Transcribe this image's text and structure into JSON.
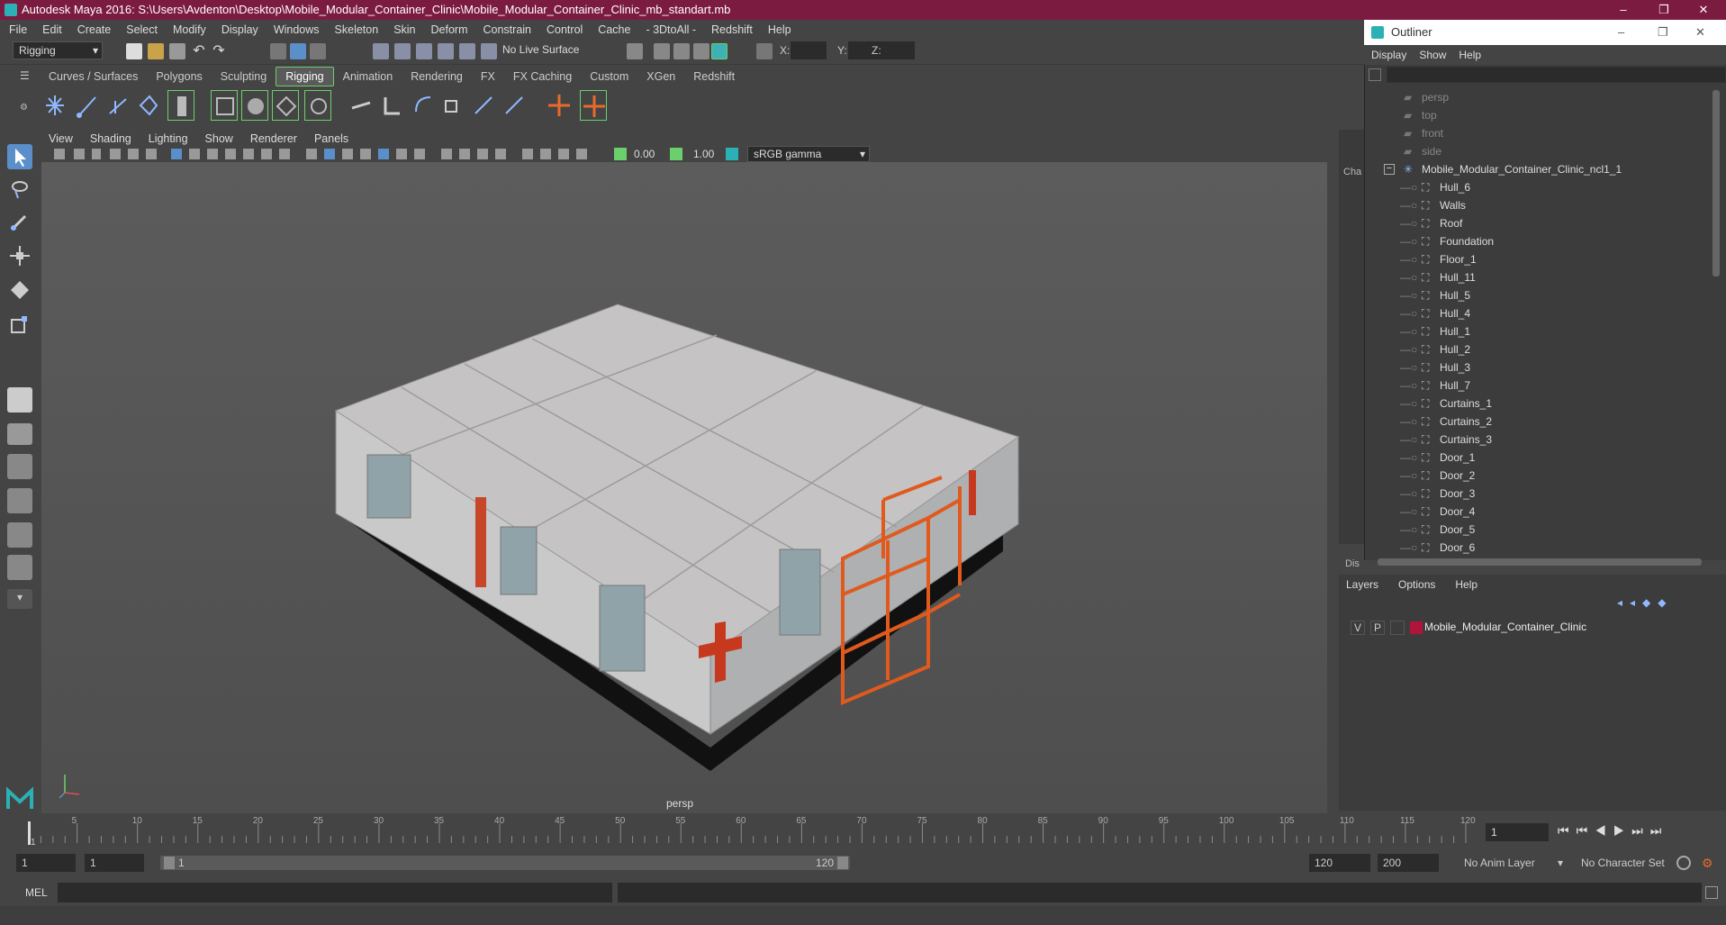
{
  "window": {
    "title": "Autodesk Maya 2016: S:\\Users\\Avdenton\\Desktop\\Mobile_Modular_Container_Clinic\\Mobile_Modular_Container_Clinic_mb_standart.mb",
    "minimize": "–",
    "maximize": "❐",
    "close": "✕"
  },
  "menubar": [
    "File",
    "Edit",
    "Create",
    "Select",
    "Modify",
    "Display",
    "Windows",
    "Skeleton",
    "Skin",
    "Deform",
    "Constrain",
    "Control",
    "Cache",
    "- 3DtoAll -",
    "Redshift",
    "Help"
  ],
  "toolbar": {
    "mode": "Rigging",
    "live_surface": "No Live Surface",
    "x_label": "X:",
    "y_label": "Y:",
    "z_label": "Z:"
  },
  "shelf_tabs": [
    "Curves / Surfaces",
    "Polygons",
    "Sculpting",
    "Rigging",
    "Animation",
    "Rendering",
    "FX",
    "FX Caching",
    "Custom",
    "XGen",
    "Redshift"
  ],
  "shelf_active": "Rigging",
  "viewport": {
    "menu": [
      "View",
      "Shading",
      "Lighting",
      "Show",
      "Renderer",
      "Panels"
    ],
    "exposure": "0.00",
    "gamma": "1.00",
    "colorspace": "sRGB gamma",
    "camera": "persp"
  },
  "outliner": {
    "title": "Outliner",
    "menu": [
      "Display",
      "Show",
      "Help"
    ],
    "cameras": [
      "persp",
      "top",
      "front",
      "side"
    ],
    "root": "Mobile_Modular_Container_Clinic_ncl1_1",
    "children": [
      "Hull_6",
      "Walls",
      "Roof",
      "Foundation",
      "Floor_1",
      "Hull_11",
      "Hull_5",
      "Hull_4",
      "Hull_1",
      "Hull_2",
      "Hull_3",
      "Hull_7",
      "Curtains_1",
      "Curtains_2",
      "Curtains_3",
      "Door_1",
      "Door_2",
      "Door_3",
      "Door_4",
      "Door_5",
      "Door_6"
    ]
  },
  "side_tabs": {
    "channel": "Cha",
    "display": "Dis"
  },
  "layers": {
    "menu": [
      "Layers",
      "Options",
      "Help"
    ],
    "v": "V",
    "p": "P",
    "name": "Mobile_Modular_Container_Clinic",
    "color": "#b0143a"
  },
  "timeline": {
    "ticks": [
      "5",
      "10",
      "15",
      "20",
      "25",
      "30",
      "35",
      "40",
      "45",
      "50",
      "55",
      "60",
      "65",
      "70",
      "75",
      "80",
      "85",
      "90",
      "95",
      "100",
      "105",
      "110",
      "115",
      "120"
    ],
    "start_tick": "1",
    "current": "1"
  },
  "range": {
    "start": "1",
    "anim_start": "1",
    "slider_start": "1",
    "slider_end": "120",
    "end": "120",
    "anim_end": "200",
    "anim_layer": "No Anim Layer",
    "char_set": "No Character Set"
  },
  "cmd": {
    "label": "MEL"
  },
  "colors": {
    "title_bar": "#7b1b3f",
    "accent_green": "#6bd06b",
    "selection_blue": "#5b8fc9",
    "maya_teal": "#2bb1b5"
  }
}
